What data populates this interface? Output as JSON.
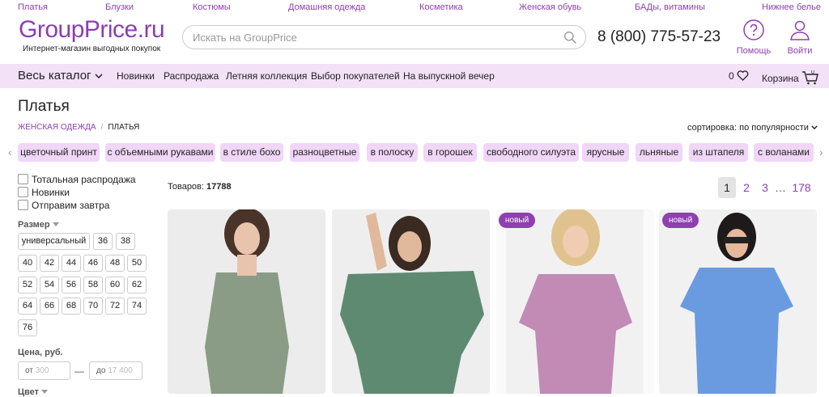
{
  "top_nav": [
    "Платья",
    "Блузки",
    "Костюмы",
    "Домашняя одежда",
    "Косметика",
    "Женская обувь",
    "БАДы, витамины",
    "Нижнее белье"
  ],
  "header": {
    "logo": "GroupPrice.ru",
    "tagline": "Интернет-магазин выгодных покупок",
    "search_placeholder": "Искать на GroupPrice",
    "phone": "8 (800) 775-57-23",
    "help_label": "Помощь",
    "login_label": "Войти"
  },
  "catalog_bar": {
    "all_label": "Весь каталог",
    "items": [
      "Новинки",
      "Распродажа",
      "Летняя коллекция",
      "Выбор покупателей",
      "На выпускной вечер"
    ],
    "favorites_count": "0",
    "cart_label": "Корзина",
    "cart_count": "0"
  },
  "page": {
    "title": "Платья",
    "breadcrumb": [
      "ЖЕНСКАЯ ОДЕЖДА",
      "ПЛАТЬЯ"
    ],
    "sort_label": "сортировка: по популярности"
  },
  "tags": [
    "цветочный принт",
    "с объемными рукавами",
    "в стиле бохо",
    "разноцветные",
    "в полоску",
    "в горошек",
    "свободного силуэта",
    "ярусные",
    "льняные",
    "из штапеля",
    "с воланами"
  ],
  "filters": {
    "checkboxes": [
      "Тотальная распродажа",
      "Новинки",
      "Отправим завтра"
    ],
    "size_label": "Размер",
    "sizes": [
      "универсальный",
      "36",
      "38",
      "40",
      "42",
      "44",
      "46",
      "48",
      "50",
      "52",
      "54",
      "56",
      "58",
      "60",
      "62",
      "64",
      "66",
      "68",
      "70",
      "72",
      "74",
      "76"
    ],
    "price_label": "Цена, руб.",
    "price_from_prefix": "от",
    "price_from_placeholder": "300",
    "price_to_prefix": "до",
    "price_to_placeholder": "17 400",
    "color_label": "Цвет"
  },
  "results": {
    "count_label": "Товаров:",
    "count": "17788"
  },
  "pagination": {
    "pages": [
      "1",
      "2",
      "3",
      "…",
      "178"
    ],
    "active": "1"
  },
  "products": [
    {
      "badge": "",
      "dress_color": "#8a9c86"
    },
    {
      "badge": "",
      "dress_color": "#5f8a72"
    },
    {
      "badge": "новый",
      "dress_color": "#c18bb6"
    },
    {
      "badge": "новый",
      "dress_color": "#6a9be0"
    }
  ],
  "colors": {
    "accent": "#8e3fb0",
    "catbar_bg": "#f3e1f8",
    "tag_bg": "#f0d6f7"
  }
}
